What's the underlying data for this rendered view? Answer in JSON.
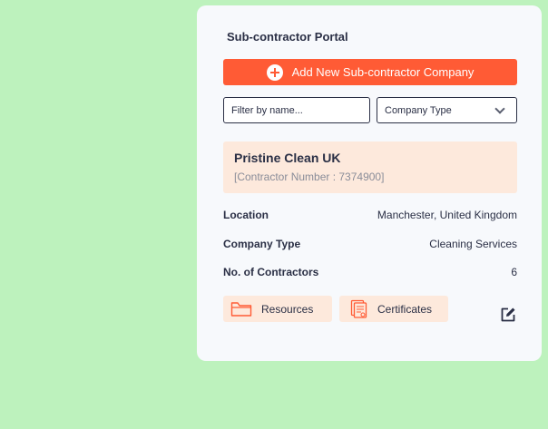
{
  "portal": {
    "title": "Sub-contractor Portal",
    "add_button_label": "Add New Sub-contractor Company"
  },
  "filters": {
    "name_placeholder": "Filter by name...",
    "company_type_selected": "Company Type"
  },
  "company": {
    "name": "Pristine Clean UK",
    "contractor_number": "[Contractor Number : 7374900]",
    "location_label": "Location",
    "location_value": "Manchester, United Kingdom",
    "type_label": "Company Type",
    "type_value": "Cleaning Services",
    "contractors_label": "No. of Contractors",
    "contractors_value": "6"
  },
  "actions": {
    "resources_label": "Resources",
    "certificates_label": "Certificates"
  },
  "icons": {
    "add": "plus-circle-icon",
    "dropdown": "chevron-down-icon",
    "resources": "folder-icon",
    "certificates": "certificate-icon",
    "edit": "edit-icon"
  },
  "colors": {
    "background": "#bdf2bd",
    "card": "#f7f9fc",
    "accent": "#ff5b35",
    "highlight": "#fde9dc",
    "text": "#2a2f45"
  }
}
